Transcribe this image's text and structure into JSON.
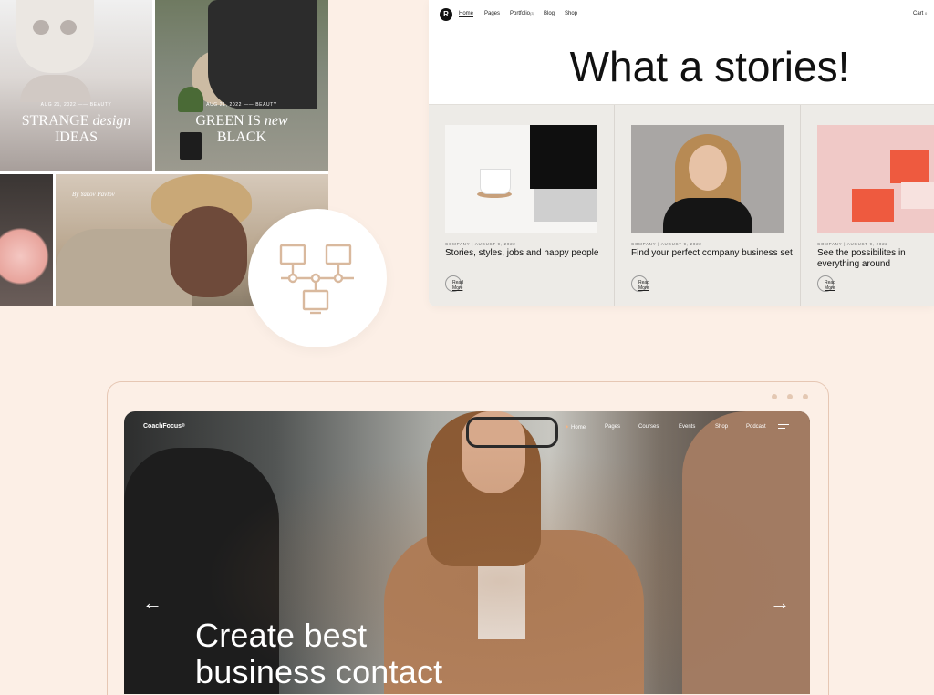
{
  "colors": {
    "background": "#FCEFE6",
    "accent_peach": "#E4C8B3",
    "card_grey": "#EDEBE7",
    "text_dark": "#111111",
    "hero_white": "#FFFFFF"
  },
  "blog_collage": {
    "tiles": [
      {
        "meta": "AUG 21, 2022 —— BEAUTY",
        "headline_line1_plain": "STRANGE ",
        "headline_line1_italic": "design",
        "headline_line2": "IDEAS"
      },
      {
        "meta": "AUG 21, 2022 —— BEAUTY",
        "headline_line1_plain": "GREEN IS ",
        "headline_line1_italic": "new",
        "headline_line2": "BLACK"
      }
    ],
    "bottom_caption": "By Yakov Pavlov"
  },
  "network_badge": {
    "icon": "network-icon"
  },
  "stories_card": {
    "logo_letter": "R",
    "nav": {
      "home": "Home",
      "pages": "Pages",
      "portfolio": "Portfolio",
      "portfolio_badge": "(3)",
      "blog": "Blog",
      "shop": "Shop",
      "cart": "Cart",
      "cart_badge": "0"
    },
    "title": "What a stories!",
    "posts": [
      {
        "meta": "COMPANY  |  AUGUST 9, 2022",
        "title": "Stories, styles, jobs and happy people",
        "read_more": "Read More"
      },
      {
        "meta": "COMPANY  |  AUGUST 9, 2022",
        "title": "Find your perfect company business set",
        "read_more": "Read More"
      },
      {
        "meta": "COMPANY  |  AUGUST 9, 2022",
        "title": "See the possibilites in everything around",
        "read_more": "Read More"
      }
    ]
  },
  "hero": {
    "brand": "CoachFocus",
    "brand_mark": "®",
    "nav": {
      "home": "Home",
      "pages": "Pages",
      "courses": "Courses",
      "events": "Events",
      "shop": "Shop",
      "podcast": "Podcast"
    },
    "arrow_left": "←",
    "arrow_right": "→",
    "title_line1": "Create best",
    "title_line2": "business contact"
  }
}
